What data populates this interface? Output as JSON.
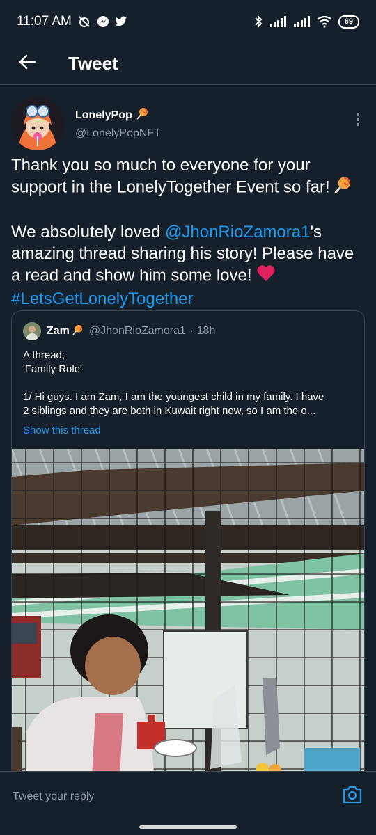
{
  "status_bar": {
    "time": "11:07 AM",
    "battery": "69",
    "icons": [
      "alarm-off-icon",
      "messenger-icon",
      "twitter-icon",
      "bluetooth-icon",
      "signal-icon",
      "signal-icon",
      "wifi-icon",
      "battery-icon"
    ]
  },
  "header": {
    "title": "Tweet",
    "back_icon": "arrow-left-icon"
  },
  "tweet": {
    "author_name": "LonelyPop",
    "author_handle": "@LonelyPopNFT",
    "para1": "Thank you so much to everyone for your support in the LonelyTogether Event so far!",
    "para2_prefix": "We absolutely loved ",
    "mention": "@JhonRioZamora1",
    "para2_suffix": "'s amazing thread sharing his story! Please have a read and show him some love!",
    "hashtag": "#LetsGetLonelyTogether",
    "emoji_lollipop": "lollipop-icon",
    "emoji_heart": "heart-icon"
  },
  "quote": {
    "name": "Zam",
    "handle": "@JhonRioZamora1",
    "time": "· 18h",
    "line1": "A thread;",
    "line2": "'Family Role'",
    "line3": "1/ Hi guys. I am Zam, I am the youngest child in my family. I have",
    "line4": "2 siblings and they are both in Kuwait right now, so I am the o...",
    "show_thread": "Show this thread"
  },
  "reply": {
    "placeholder": "Tweet your reply"
  },
  "colors": {
    "background": "#15202b",
    "accent": "#1d9bf0",
    "secondary_text": "#8899a6",
    "divider": "#38444d"
  }
}
